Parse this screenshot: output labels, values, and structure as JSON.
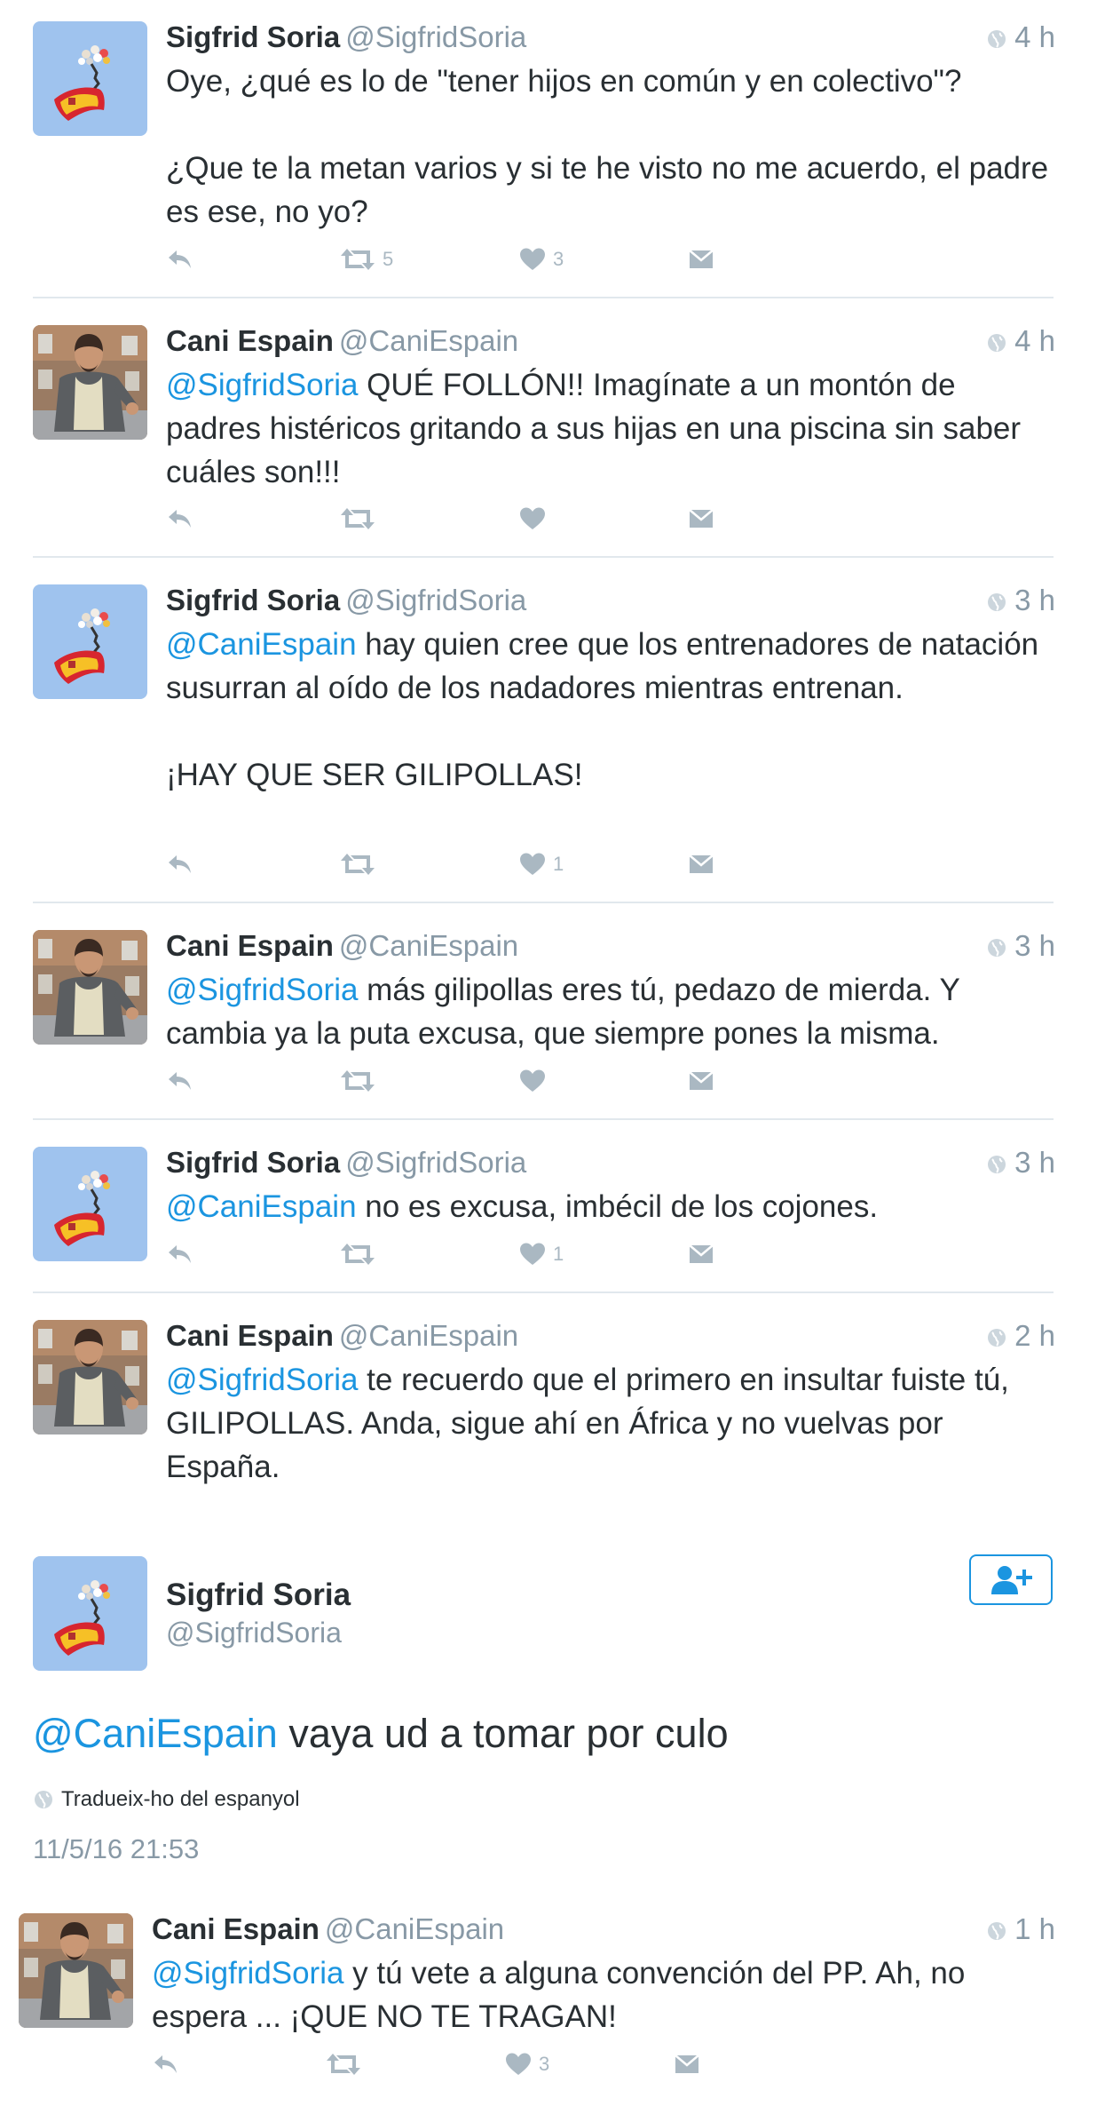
{
  "tweets": [
    {
      "name": "Sigfrid Soria",
      "handle": "@SigfridSoria",
      "time": "4 h",
      "paragraphs": [
        [
          {
            "t": "Oye, ¿qué es lo de \"tener hijos en común y en colectivo\"?"
          }
        ],
        [
          {
            "t": "¿Que te la metan varios y si te he visto no me acuerdo, el padre es ese, no yo?"
          }
        ]
      ],
      "retweets": "5",
      "likes": "3"
    },
    {
      "name": "Cani Espain",
      "handle": "@CaniEspain",
      "time": "4 h",
      "paragraphs": [
        [
          {
            "m": "@SigfridSoria"
          },
          {
            "t": " QUÉ FOLLÓN!! Imagínate a un montón de padres histéricos gritando a sus hijas en una piscina sin saber cuáles son!!!"
          }
        ]
      ],
      "retweets": "",
      "likes": ""
    },
    {
      "name": "Sigfrid Soria",
      "handle": "@SigfridSoria",
      "time": "3 h",
      "paragraphs": [
        [
          {
            "m": "@CaniEspain"
          },
          {
            "t": " hay quien cree que los entrenadores de natación susurran al oído de los nadadores mientras entrenan."
          }
        ],
        [
          {
            "t": "¡HAY QUE SER GILIPOLLAS!"
          }
        ]
      ],
      "retweets": "",
      "likes": "1"
    },
    {
      "name": "Cani Espain",
      "handle": "@CaniEspain",
      "time": "3 h",
      "paragraphs": [
        [
          {
            "m": "@SigfridSoria"
          },
          {
            "t": " más gilipollas eres tú, pedazo de mierda. Y cambia ya la puta excusa, que siempre pones la misma."
          }
        ]
      ],
      "retweets": "",
      "likes": ""
    },
    {
      "name": "Sigfrid Soria",
      "handle": "@SigfridSoria",
      "time": "3 h",
      "paragraphs": [
        [
          {
            "m": "@CaniEspain"
          },
          {
            "t": " no es excusa, imbécil de los cojones."
          }
        ]
      ],
      "retweets": "",
      "likes": "1"
    },
    {
      "name": "Cani Espain",
      "handle": "@CaniEspain",
      "time": "2 h",
      "paragraphs": [
        [
          {
            "m": "@SigfridSoria"
          },
          {
            "t": " te recuerdo que el primero en insultar fuiste tú, GILIPOLLAS. Anda, sigue ahí en África y no vuelvas por España."
          }
        ]
      ]
    }
  ],
  "main": {
    "name": "Sigfrid Soria",
    "handle": "@SigfridSoria",
    "mention": "@CaniEspain",
    "text": " vaya ud a tomar por culo",
    "translate": "Tradueix-ho del espanyol",
    "timestamp": "11/5/16 21:53"
  },
  "reply": {
    "name": "Cani Espain",
    "handle": "@CaniEspain",
    "time": "1 h",
    "paragraphs": [
      [
        {
          "m": "@SigfridSoria"
        },
        {
          "t": " y tú vete a alguna convención del PP. Ah, no espera ... ¡QUE NO TE TRAGAN!"
        }
      ]
    ],
    "retweets": "",
    "likes": "3"
  },
  "icons": {
    "reply": "reply-icon",
    "retweet": "retweet-icon",
    "like": "heart-icon",
    "dm": "envelope-icon",
    "globe": "globe-icon",
    "follow": "follow-user-icon"
  },
  "colors": {
    "link": "#1b95e0",
    "secondary": "#8899a6",
    "action": "#aab8c2",
    "text": "#292f33"
  }
}
